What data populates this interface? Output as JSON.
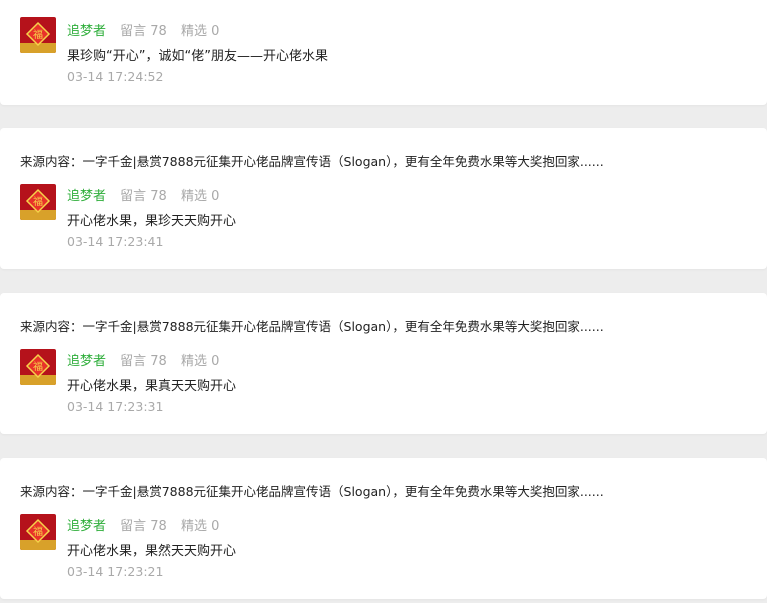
{
  "theme": {
    "nickname_color": "#2fae3b",
    "muted_color": "#a9a9a9",
    "text_color": "#222222",
    "background": "#ededed",
    "card_background": "#ffffff"
  },
  "cards": [
    {
      "source": "",
      "nickname": "追梦者",
      "comments_stat": "留言 78",
      "featured_stat": "精选 0",
      "comment": "果珍购“开心”，诚如“佬”朋友——开心佬水果",
      "time": "03-14 17:24:52"
    },
    {
      "source": "来源内容：一字千金|悬赏7888元征集开心佬品牌宣传语（Slogan），更有全年免费水果等大奖抱回家......",
      "nickname": "追梦者",
      "comments_stat": "留言 78",
      "featured_stat": "精选 0",
      "comment": "开心佬水果，果珍天天购开心",
      "time": "03-14 17:23:41"
    },
    {
      "source": "来源内容：一字千金|悬赏7888元征集开心佬品牌宣传语（Slogan），更有全年免费水果等大奖抱回家......",
      "nickname": "追梦者",
      "comments_stat": "留言 78",
      "featured_stat": "精选 0",
      "comment": "开心佬水果，果真天天购开心",
      "time": "03-14 17:23:31"
    },
    {
      "source": "来源内容：一字千金|悬赏7888元征集开心佬品牌宣传语（Slogan），更有全年免费水果等大奖抱回家......",
      "nickname": "追梦者",
      "comments_stat": "留言 78",
      "featured_stat": "精选 0",
      "comment": "开心佬水果，果然天天购开心",
      "time": "03-14 17:23:21"
    }
  ]
}
